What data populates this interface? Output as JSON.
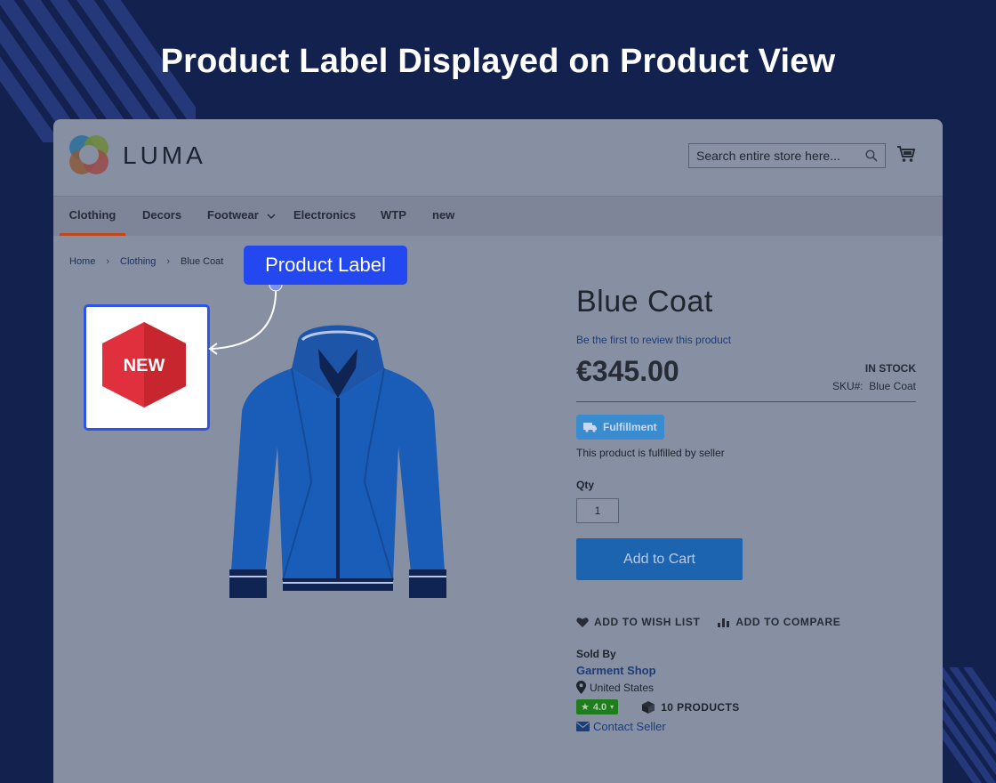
{
  "hero": {
    "title": "Product Label Displayed on Product View"
  },
  "store": {
    "logo_text": "LUMA",
    "search_placeholder": "Search entire store here...",
    "nav": [
      {
        "label": "Clothing",
        "active": true
      },
      {
        "label": "Decors"
      },
      {
        "label": "Footwear",
        "has_dropdown": true
      },
      {
        "label": "Electronics"
      },
      {
        "label": "WTP"
      },
      {
        "label": "new"
      }
    ],
    "breadcrumb": [
      "Home",
      "Clothing",
      "Blue Coat"
    ]
  },
  "annotation": {
    "product_label_tag": "Product Label",
    "badge_text": "NEW",
    "badge_color": "#e0303e"
  },
  "product": {
    "name": "Blue Coat",
    "review_link": "Be the first to review this product",
    "price": "€345.00",
    "stock": "IN STOCK",
    "sku_label": "SKU#:",
    "sku_value": "Blue Coat",
    "fulfillment_badge": "Fulfillment",
    "fulfillment_note": "This product is fulfilled by seller",
    "qty_label": "Qty",
    "qty_value": "1",
    "add_to_cart": "Add to Cart",
    "wishlist": "ADD TO WISH LIST",
    "compare": "ADD TO COMPARE"
  },
  "seller": {
    "sold_by": "Sold By",
    "name": "Garment Shop",
    "location": "United States",
    "rating": "4.0",
    "products": "10 PRODUCTS",
    "contact": "Contact Seller"
  },
  "colors": {
    "background": "#13214f",
    "accent_blue": "#2448f0",
    "overlay": "#878fa3",
    "nav_active": "#c0461c"
  }
}
